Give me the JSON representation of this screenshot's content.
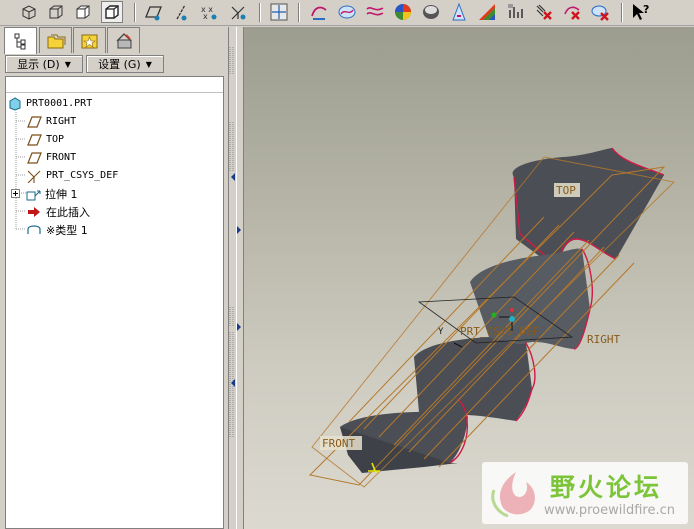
{
  "toolbar": {
    "buttons": [
      {
        "icon": "view-isometric-icon"
      },
      {
        "icon": "view-shaded-box-icon"
      },
      {
        "icon": "view-hidden-box-icon"
      },
      {
        "icon": "view-solid-box-icon",
        "active": true
      },
      {
        "icon": "datum-plane-display-icon"
      },
      {
        "icon": "datum-axis-display-icon"
      },
      {
        "icon": "datum-point-display-icon"
      },
      {
        "icon": "csys-display-icon"
      },
      {
        "icon": "sketch-tool-icon"
      },
      {
        "icon": "style-curve-icon"
      },
      {
        "icon": "curve-analysis-icon"
      },
      {
        "icon": "reflection-analysis-icon"
      },
      {
        "icon": "shaded-analysis-icon"
      },
      {
        "icon": "draft-analysis-icon"
      },
      {
        "icon": "gaussian-curvature-icon"
      },
      {
        "icon": "slope-analysis-icon"
      },
      {
        "icon": "section-analysis-icon"
      },
      {
        "icon": "delete-analysis-icon"
      },
      {
        "icon": "hide-analysis-icon"
      },
      {
        "icon": "context-help-icon",
        "text": "?"
      }
    ]
  },
  "nav_tabs": [
    {
      "icon": "model-tree-tab-icon",
      "selected": true
    },
    {
      "icon": "folder-browser-tab-icon"
    },
    {
      "icon": "favorites-tab-icon"
    },
    {
      "icon": "connections-tab-icon"
    }
  ],
  "menus": {
    "show_label": "显示 (D)",
    "settings_label": "设置 (G)"
  },
  "tree": {
    "root": "PRT0001.PRT",
    "items": [
      {
        "label": "RIGHT",
        "icon": "datum-plane-icon"
      },
      {
        "label": "TOP",
        "icon": "datum-plane-icon"
      },
      {
        "label": "FRONT",
        "icon": "datum-plane-icon"
      },
      {
        "label": "PRT_CSYS_DEF",
        "icon": "csys-icon"
      },
      {
        "label": "拉伸 1",
        "icon": "extrude-icon",
        "expandable": true
      },
      {
        "label": "在此插入",
        "icon": "insert-here-arrow-icon"
      },
      {
        "label": "※类型 1",
        "icon": "surface-icon"
      }
    ]
  },
  "viewport": {
    "labels": {
      "top": "TOP",
      "right": "RIGHT",
      "front": "FRONT",
      "csys": "PRT_CSYS_DEF",
      "axis_y": "Y"
    },
    "colors": {
      "surface": "#4b4e55",
      "edge": "#d01a46",
      "datum": "#b5782a"
    }
  },
  "watermark": {
    "title": "野火论坛",
    "url": "www.proewildfire.cn"
  }
}
